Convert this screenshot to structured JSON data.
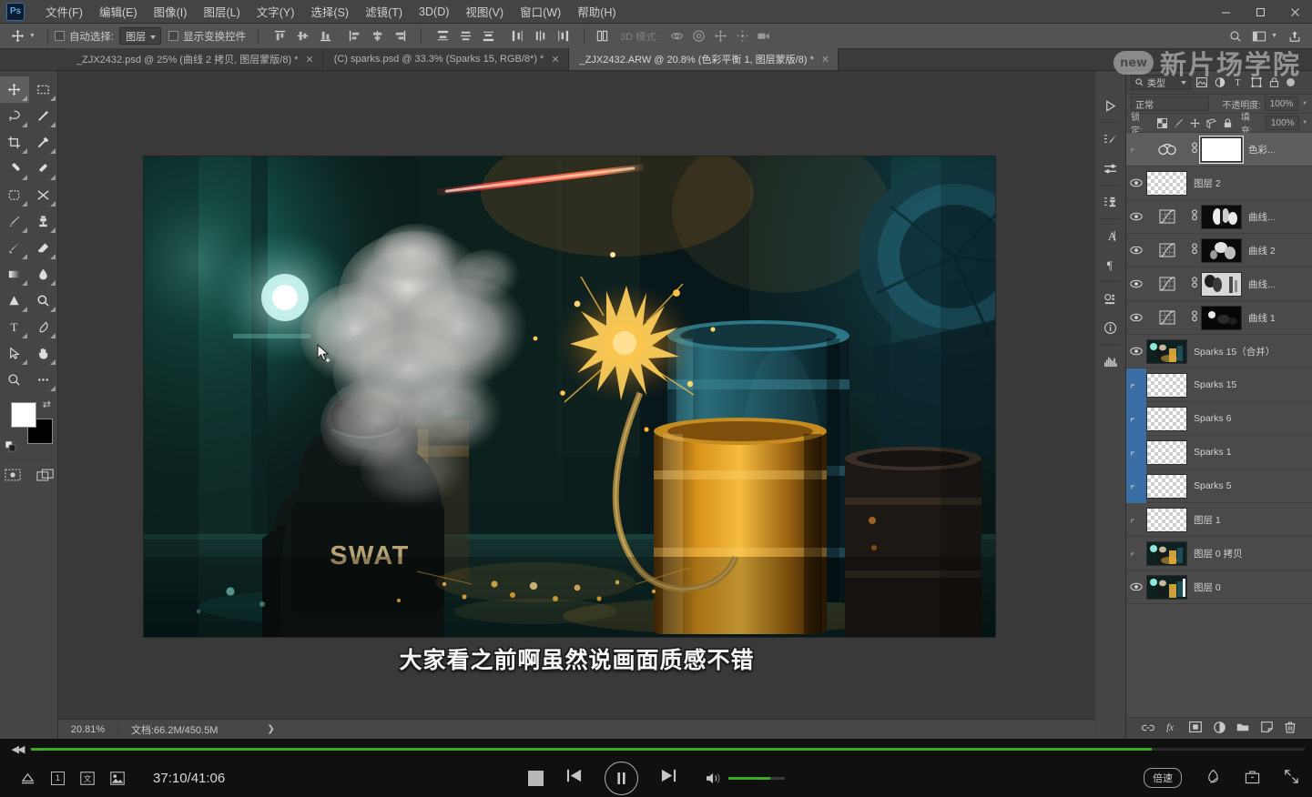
{
  "app": {
    "name": "Adobe Photoshop",
    "logo_text": "Ps"
  },
  "menubar": {
    "items": [
      {
        "label": "文件(F)",
        "name": "menu-file"
      },
      {
        "label": "编辑(E)",
        "name": "menu-edit"
      },
      {
        "label": "图像(I)",
        "name": "menu-image"
      },
      {
        "label": "图层(L)",
        "name": "menu-layer"
      },
      {
        "label": "文字(Y)",
        "name": "menu-type"
      },
      {
        "label": "选择(S)",
        "name": "menu-select"
      },
      {
        "label": "滤镜(T)",
        "name": "menu-filter"
      },
      {
        "label": "3D(D)",
        "name": "menu-3d"
      },
      {
        "label": "视图(V)",
        "name": "menu-view"
      },
      {
        "label": "窗口(W)",
        "name": "menu-window"
      },
      {
        "label": "帮助(H)",
        "name": "menu-help"
      }
    ],
    "window_controls": {
      "minimize": "—",
      "maximize": "▢",
      "close": "✕"
    }
  },
  "options_bar": {
    "tool_icon": "move-tool",
    "auto_select_label": "自动选择:",
    "auto_select_value": "图层",
    "show_transform_label": "显示变换控件",
    "mode_3d_label": "3D 模式:",
    "align_icons": [
      "align-top-edges",
      "align-vertical-centers",
      "align-bottom-edges",
      "align-left-edges",
      "align-horizontal-centers",
      "align-right-edges",
      "distribute-top",
      "distribute-vertical-center",
      "distribute-bottom",
      "distribute-left",
      "distribute-horizontal-center",
      "distribute-right"
    ],
    "right_icons": [
      "search-icon",
      "workspace-icon",
      "share-icon"
    ]
  },
  "document_tabs": [
    {
      "label": "_ZJX2432.psd @ 25% (曲线 2 拷贝, 图层蒙版/8) *",
      "active": false,
      "close": "✕"
    },
    {
      "label": "(C) sparks.psd @ 33.3% (Sparks 15, RGB/8*) *",
      "active": false,
      "close": "✕"
    },
    {
      "label": "_ZJX2432.ARW @ 20.8% (色彩平衡 1, 图层蒙版/8) *",
      "active": true,
      "close": "✕"
    }
  ],
  "toolbar": {
    "tools": [
      [
        "move-tool",
        "rectangular-marquee-tool"
      ],
      [
        "lasso-tool",
        "magic-wand-tool"
      ],
      [
        "crop-tool",
        "eyedropper-tool"
      ],
      [
        "spot-healing-brush-tool",
        "brush-tool-alt"
      ],
      [
        "patch-tool",
        "shuffle-tool"
      ],
      [
        "paintbrush-tool",
        "clone-stamp-tool"
      ],
      [
        "history-brush-tool",
        "eraser-tool"
      ],
      [
        "gradient-tool",
        "blur-tool"
      ],
      [
        "dodge-tool",
        "burn-tool"
      ],
      [
        "type-tool",
        "pen-tool"
      ],
      [
        "path-selection-tool",
        "hand-tool"
      ],
      [
        "zoom-tool",
        "more-tools-icon"
      ]
    ],
    "foreground_color": "#ffffff",
    "background_color": "#000000",
    "quickmask_icons": [
      "quick-mask-icon",
      "screen-mode-icon"
    ]
  },
  "canvas": {
    "subtitle_text": "大家看之前啊虽然说画面质感不错",
    "cursor": "move-cursor"
  },
  "ps_status": {
    "zoom": "20.81%",
    "doc_label": "文档:66.2M/450.5M",
    "arrow": "❯"
  },
  "dock_strip": {
    "icons": [
      "play-panel-icon",
      "brush-settings-icon",
      "sliders-icon",
      "clone-source-icon",
      "character-panel-icon",
      "paragraph-panel-icon",
      "3d-panel-icon",
      "info-panel-icon",
      "histogram-panel-icon"
    ]
  },
  "layers_panel": {
    "filter_label": "类型",
    "header_icons": [
      "filter-pixel-icon",
      "filter-adjustment-icon",
      "filter-type-icon",
      "filter-shape-icon",
      "filter-smart-object-icon"
    ],
    "blend_mode": "正常",
    "opacity_label": "不透明度:",
    "opacity_value": "100%",
    "lock_label": "锁定:",
    "lock_icons": [
      "lock-transparent-pixels-icon",
      "lock-image-pixels-icon",
      "lock-position-icon",
      "lock-artboard-icon",
      "lock-all-icon"
    ],
    "fill_label": "填充:",
    "fill_value": "100%",
    "layers": [
      {
        "name": "色彩...",
        "visible": false,
        "selected": true,
        "thumb": "adjustment",
        "adj_icon": "color-balance-icon",
        "has_link": true,
        "mask": "white",
        "group_selected": false
      },
      {
        "name": "图层 2",
        "visible": true,
        "selected": false,
        "thumb": "transparent",
        "has_link": false,
        "mask": null,
        "group_selected": false
      },
      {
        "name": "曲线...",
        "visible": true,
        "selected": false,
        "thumb": "adjustment",
        "adj_icon": "curves-icon",
        "has_link": true,
        "mask": "dark-blur",
        "group_selected": false
      },
      {
        "name": "曲线 2",
        "visible": true,
        "selected": false,
        "thumb": "adjustment",
        "adj_icon": "curves-icon",
        "has_link": true,
        "mask": "dark-blur2",
        "group_selected": false
      },
      {
        "name": "曲线...",
        "visible": true,
        "selected": false,
        "thumb": "adjustment",
        "adj_icon": "curves-icon",
        "has_link": true,
        "mask": "light-blur",
        "group_selected": false
      },
      {
        "name": "曲线 1",
        "visible": true,
        "selected": false,
        "thumb": "adjustment",
        "adj_icon": "curves-icon",
        "has_link": true,
        "mask": "very-dark",
        "group_selected": false
      },
      {
        "name": "Sparks 15（合并）",
        "visible": true,
        "selected": false,
        "thumb": "photo",
        "has_link": false,
        "mask": null,
        "group_selected": false
      },
      {
        "name": "Sparks 15",
        "visible": false,
        "selected": false,
        "thumb": "transparent",
        "has_link": false,
        "mask": null,
        "group_selected": true
      },
      {
        "name": "Sparks 6",
        "visible": false,
        "selected": false,
        "thumb": "transparent",
        "has_link": false,
        "mask": null,
        "group_selected": true
      },
      {
        "name": "Sparks 1",
        "visible": false,
        "selected": false,
        "thumb": "transparent",
        "has_link": false,
        "mask": null,
        "group_selected": true
      },
      {
        "name": "Sparks 5",
        "visible": false,
        "selected": false,
        "thumb": "transparent",
        "has_link": false,
        "mask": null,
        "group_selected": true
      },
      {
        "name": "图层 1",
        "visible": false,
        "selected": false,
        "thumb": "transparent",
        "has_link": false,
        "mask": null,
        "group_selected": false
      },
      {
        "name": "图层 0 拷贝",
        "visible": false,
        "selected": false,
        "thumb": "photo",
        "has_link": false,
        "mask": null,
        "group_selected": false
      },
      {
        "name": "图层 0",
        "visible": true,
        "selected": false,
        "thumb": "photo-bg",
        "has_link": false,
        "mask": null,
        "group_selected": false
      }
    ],
    "footer_icons": [
      "link-layers-icon",
      "layer-style-fx-icon",
      "add-layer-mask-icon",
      "new-adjustment-layer-icon",
      "new-group-icon",
      "new-layer-icon",
      "delete-layer-icon"
    ]
  },
  "watermark": {
    "badge": "new",
    "text": "新片场学院"
  },
  "player": {
    "rewind_icon": "rewind-icon",
    "progress_percent": 88,
    "left_icons": [
      "eject-icon",
      "chapter-1-icon",
      "subtitle-track-icon",
      "screenshot-icon"
    ],
    "time": "37:10/41:06",
    "stop_icon": "stop-icon",
    "prev_icon": "previous-icon",
    "play_pause_icon": "pause-icon",
    "next_icon": "next-icon",
    "volume_icon": "volume-icon",
    "volume_percent": 75,
    "speed_label": "倍速",
    "right_icons": [
      "snapshot-icon",
      "briefcase-icon",
      "fullscreen-icon"
    ]
  }
}
